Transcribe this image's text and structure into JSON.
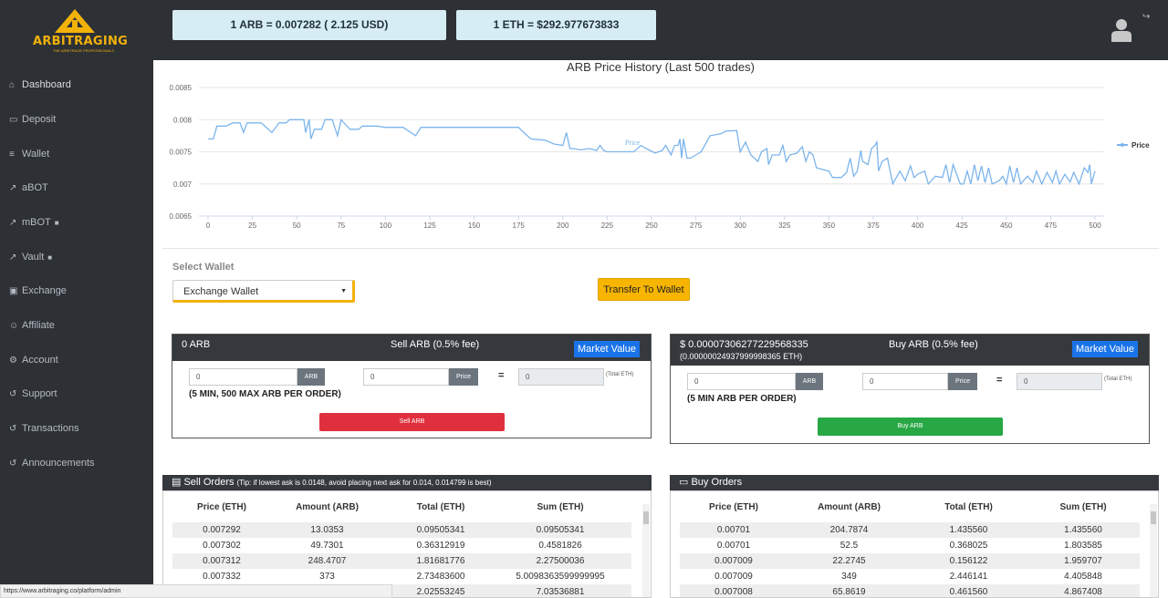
{
  "header": {
    "logo_text": "ARBITRAGING",
    "logo_subtext": "THE ARBITRAGE PROFESSIONALS",
    "arb_rate": "1 ARB = 0.007282 ( 2.125 USD)",
    "eth_rate": "1 ETH = $292.977673833",
    "user_icon": "user-icon",
    "logout_icon": "logout-icon"
  },
  "sidebar": {
    "items": [
      {
        "label": "Dashboard",
        "icon": "home-icon",
        "locked": false
      },
      {
        "label": "Deposit",
        "icon": "card-icon",
        "locked": false
      },
      {
        "label": "Wallet",
        "icon": "bank-icon",
        "locked": false
      },
      {
        "label": "aBOT",
        "icon": "line-chart-icon",
        "locked": false
      },
      {
        "label": "mBOT",
        "icon": "line-chart-icon",
        "locked": true
      },
      {
        "label": "Vault",
        "icon": "line-chart-icon",
        "locked": true
      },
      {
        "label": "Exchange",
        "icon": "money-icon",
        "locked": false
      },
      {
        "label": "Affiliate",
        "icon": "users-icon",
        "locked": false
      },
      {
        "label": "Account",
        "icon": "cogs-icon",
        "locked": false
      },
      {
        "label": "Support",
        "icon": "history-icon",
        "locked": false
      },
      {
        "label": "Transactions",
        "icon": "history-icon",
        "locked": false
      },
      {
        "label": "Announcements",
        "icon": "history-icon",
        "locked": false
      }
    ]
  },
  "chart_data": {
    "type": "line",
    "title": "ARB Price History (Last 500 trades)",
    "xlabel": "",
    "ylabel": "",
    "xlim": [
      0,
      500
    ],
    "ylim": [
      0.0065,
      0.0085
    ],
    "x_ticks": [
      "0",
      "25",
      "50",
      "75",
      "100",
      "125",
      "150",
      "175",
      "200",
      "225",
      "250",
      "275",
      "300",
      "325",
      "350",
      "375",
      "400",
      "425",
      "450",
      "475",
      "500"
    ],
    "y_ticks": [
      "0.0085",
      "0.008",
      "0.0075",
      "0.007",
      "0.0065"
    ],
    "grid": true,
    "legend": "right",
    "series": [
      {
        "name": "Price",
        "color": "#7cb5ec",
        "points": [
          [
            0,
            0.0077
          ],
          [
            3,
            0.0077
          ],
          [
            5,
            0.0079
          ],
          [
            10,
            0.0079
          ],
          [
            14,
            0.00795
          ],
          [
            18,
            0.00795
          ],
          [
            20,
            0.0078
          ],
          [
            22,
            0.00795
          ],
          [
            30,
            0.00795
          ],
          [
            36,
            0.0078
          ],
          [
            40,
            0.00795
          ],
          [
            44,
            0.00795
          ],
          [
            46,
            0.008
          ],
          [
            54,
            0.008
          ],
          [
            55,
            0.0078
          ],
          [
            57,
            0.008
          ],
          [
            58,
            0.0077
          ],
          [
            60,
            0.00785
          ],
          [
            64,
            0.00785
          ],
          [
            66,
            0.008
          ],
          [
            70,
            0.008
          ],
          [
            73,
            0.00775
          ],
          [
            75,
            0.008
          ],
          [
            80,
            0.00785
          ],
          [
            85,
            0.00785
          ],
          [
            87,
            0.0079
          ],
          [
            95,
            0.0079
          ],
          [
            100,
            0.00788
          ],
          [
            105,
            0.00788
          ],
          [
            110,
            0.00788
          ],
          [
            117,
            0.00775
          ],
          [
            120,
            0.00788
          ],
          [
            130,
            0.00788
          ],
          [
            150,
            0.00788
          ],
          [
            160,
            0.00788
          ],
          [
            175,
            0.00788
          ],
          [
            178,
            0.0078
          ],
          [
            182,
            0.0077
          ],
          [
            190,
            0.00768
          ],
          [
            195,
            0.00762
          ],
          [
            200,
            0.0076
          ],
          [
            202,
            0.0078
          ],
          [
            204,
            0.00755
          ],
          [
            206,
            0.00755
          ],
          [
            210,
            0.00753
          ],
          [
            215,
            0.00755
          ],
          [
            219,
            0.00752
          ],
          [
            221,
            0.0076
          ],
          [
            223,
            0.00752
          ],
          [
            225,
            0.0075
          ],
          [
            235,
            0.0075
          ],
          [
            240,
            0.0075
          ],
          [
            244,
            0.0076
          ],
          [
            247,
            0.00755
          ],
          [
            252,
            0.00748
          ],
          [
            256,
            0.00752
          ],
          [
            258,
            0.0076
          ],
          [
            261,
            0.00745
          ],
          [
            263,
            0.0076
          ],
          [
            265,
            0.0076
          ],
          [
            266,
            0.0077
          ],
          [
            267,
            0.0074
          ],
          [
            268,
            0.0077
          ],
          [
            270,
            0.0074
          ],
          [
            272,
            0.0074
          ],
          [
            275,
            0.00745
          ],
          [
            278,
            0.0075
          ],
          [
            283,
            0.00775
          ],
          [
            289,
            0.00778
          ],
          [
            292,
            0.00782
          ],
          [
            298,
            0.00783
          ],
          [
            300,
            0.0075
          ],
          [
            303,
            0.00765
          ],
          [
            306,
            0.00745
          ],
          [
            310,
            0.00735
          ],
          [
            312,
            0.0075
          ],
          [
            315,
            0.00755
          ],
          [
            316,
            0.0073
          ],
          [
            318,
            0.00745
          ],
          [
            322,
            0.00745
          ],
          [
            324,
            0.0076
          ],
          [
            326,
            0.00735
          ],
          [
            328,
            0.00745
          ],
          [
            332,
            0.00748
          ],
          [
            335,
            0.00758
          ],
          [
            337,
            0.00735
          ],
          [
            339,
            0.0075
          ],
          [
            341,
            0.00745
          ],
          [
            343,
            0.00725
          ],
          [
            347,
            0.00722
          ],
          [
            350,
            0.0072
          ],
          [
            352,
            0.0071
          ],
          [
            357,
            0.0071
          ],
          [
            360,
            0.00718
          ],
          [
            362,
            0.0074
          ],
          [
            364,
            0.00712
          ],
          [
            366,
            0.0072
          ],
          [
            368,
            0.00752
          ],
          [
            369,
            0.00735
          ],
          [
            372,
            0.0073
          ],
          [
            374,
            0.00755
          ],
          [
            376,
            0.0076
          ],
          [
            377,
            0.00765
          ],
          [
            378,
            0.0072
          ],
          [
            380,
            0.00735
          ],
          [
            383,
            0.0074
          ],
          [
            386,
            0.007
          ],
          [
            390,
            0.0072
          ],
          [
            393,
            0.00705
          ],
          [
            396,
            0.00728
          ],
          [
            398,
            0.0071
          ],
          [
            400,
            0.00715
          ],
          [
            404,
            0.0072
          ],
          [
            406,
            0.007
          ],
          [
            410,
            0.00712
          ],
          [
            414,
            0.0071
          ],
          [
            416,
            0.0073
          ],
          [
            418,
            0.00702
          ],
          [
            420,
            0.0073
          ],
          [
            424,
            0.007
          ],
          [
            426,
            0.007
          ],
          [
            428,
            0.0072
          ],
          [
            430,
            0.007
          ],
          [
            432,
            0.0073
          ],
          [
            434,
            0.00705
          ],
          [
            436,
            0.00728
          ],
          [
            438,
            0.00702
          ],
          [
            440,
            0.00725
          ],
          [
            442,
            0.007
          ],
          [
            446,
            0.00705
          ],
          [
            448,
            0.00712
          ],
          [
            450,
            0.007
          ],
          [
            452,
            0.00728
          ],
          [
            454,
            0.00702
          ],
          [
            456,
            0.00725
          ],
          [
            458,
            0.007
          ],
          [
            462,
            0.00712
          ],
          [
            465,
            0.00702
          ],
          [
            467,
            0.0072
          ],
          [
            470,
            0.007
          ],
          [
            473,
            0.00718
          ],
          [
            476,
            0.00702
          ],
          [
            478,
            0.0072
          ],
          [
            480,
            0.007
          ],
          [
            483,
            0.00715
          ],
          [
            486,
            0.00703
          ],
          [
            488,
            0.00718
          ],
          [
            491,
            0.007
          ],
          [
            494,
            0.00725
          ],
          [
            496,
            0.00718
          ],
          [
            497,
            0.0073
          ],
          [
            498,
            0.007
          ],
          [
            500,
            0.0072
          ]
        ]
      }
    ],
    "label_text": "Price"
  },
  "wallet": {
    "label": "Select Wallet",
    "selected": "Exchange Wallet",
    "transfer_label": "Transfer To Wallet"
  },
  "sell_panel": {
    "balance": "0 ARB",
    "title": "Sell ARB (0.5% fee)",
    "market_value": "Market Value",
    "amount_value": "0",
    "amount_addon": "ARB",
    "price_value": "0",
    "price_addon": "Price",
    "equals": "=",
    "total_value": "0",
    "total_label": "(Total ETH)",
    "note": "(5 MIN, 500 MAX ARB PER ORDER)",
    "button": "Sell ARB"
  },
  "buy_panel": {
    "balance": "$ 0.00007306277229568335",
    "balance_eth": "(0.00000024937999998365 ETH)",
    "title": "Buy ARB (0.5% fee)",
    "market_value": "Market Value",
    "amount_value": "0",
    "amount_addon": "ARB",
    "price_value": "0",
    "price_addon": "Price",
    "equals": "=",
    "total_value": "0",
    "total_label": "(Total ETH)",
    "note": "(5 MIN ARB PER ORDER)",
    "button": "Buy ARB"
  },
  "sell_orders": {
    "title": "Sell Orders",
    "tip": "(Tip: if lowest ask is 0.0148, avoid placing next ask for 0.014, 0.014799 is best)",
    "columns": [
      "Price (ETH)",
      "Amount (ARB)",
      "Total (ETH)",
      "Sum (ETH)"
    ],
    "rows": [
      [
        "0.007292",
        "13.0353",
        "0.09505341",
        "0.09505341"
      ],
      [
        "0.007302",
        "49.7301",
        "0.36312919",
        "0.4581826"
      ],
      [
        "0.007312",
        "248.4707",
        "1.81681776",
        "2.27500036"
      ],
      [
        "0.007332",
        "373",
        "2.73483600",
        "5.0098363599999995"
      ],
      [
        "",
        "",
        "2.02553245",
        "7.03536881"
      ]
    ]
  },
  "buy_orders": {
    "title": "Buy Orders",
    "columns": [
      "Price (ETH)",
      "Amount (ARB)",
      "Total (ETH)",
      "Sum (ETH)"
    ],
    "rows": [
      [
        "0.00701",
        "204.7874",
        "1.435560",
        "1.435560"
      ],
      [
        "0.00701",
        "52.5",
        "0.368025",
        "1.803585"
      ],
      [
        "0.007009",
        "22.2745",
        "0.156122",
        "1.959707"
      ],
      [
        "0.007009",
        "349",
        "2.446141",
        "4.405848"
      ],
      [
        "0.007008",
        "65.8619",
        "0.461560",
        "4.867408"
      ]
    ]
  },
  "status_url": "https://www.arbitraging.co/platform/admin",
  "colors": {
    "sidebar_bg": "#2d3035",
    "accent": "#f7b500",
    "market_blue": "#1a73e8",
    "sell_red": "#e0303d",
    "buy_green": "#28a745",
    "line": "#7cb5ec"
  }
}
